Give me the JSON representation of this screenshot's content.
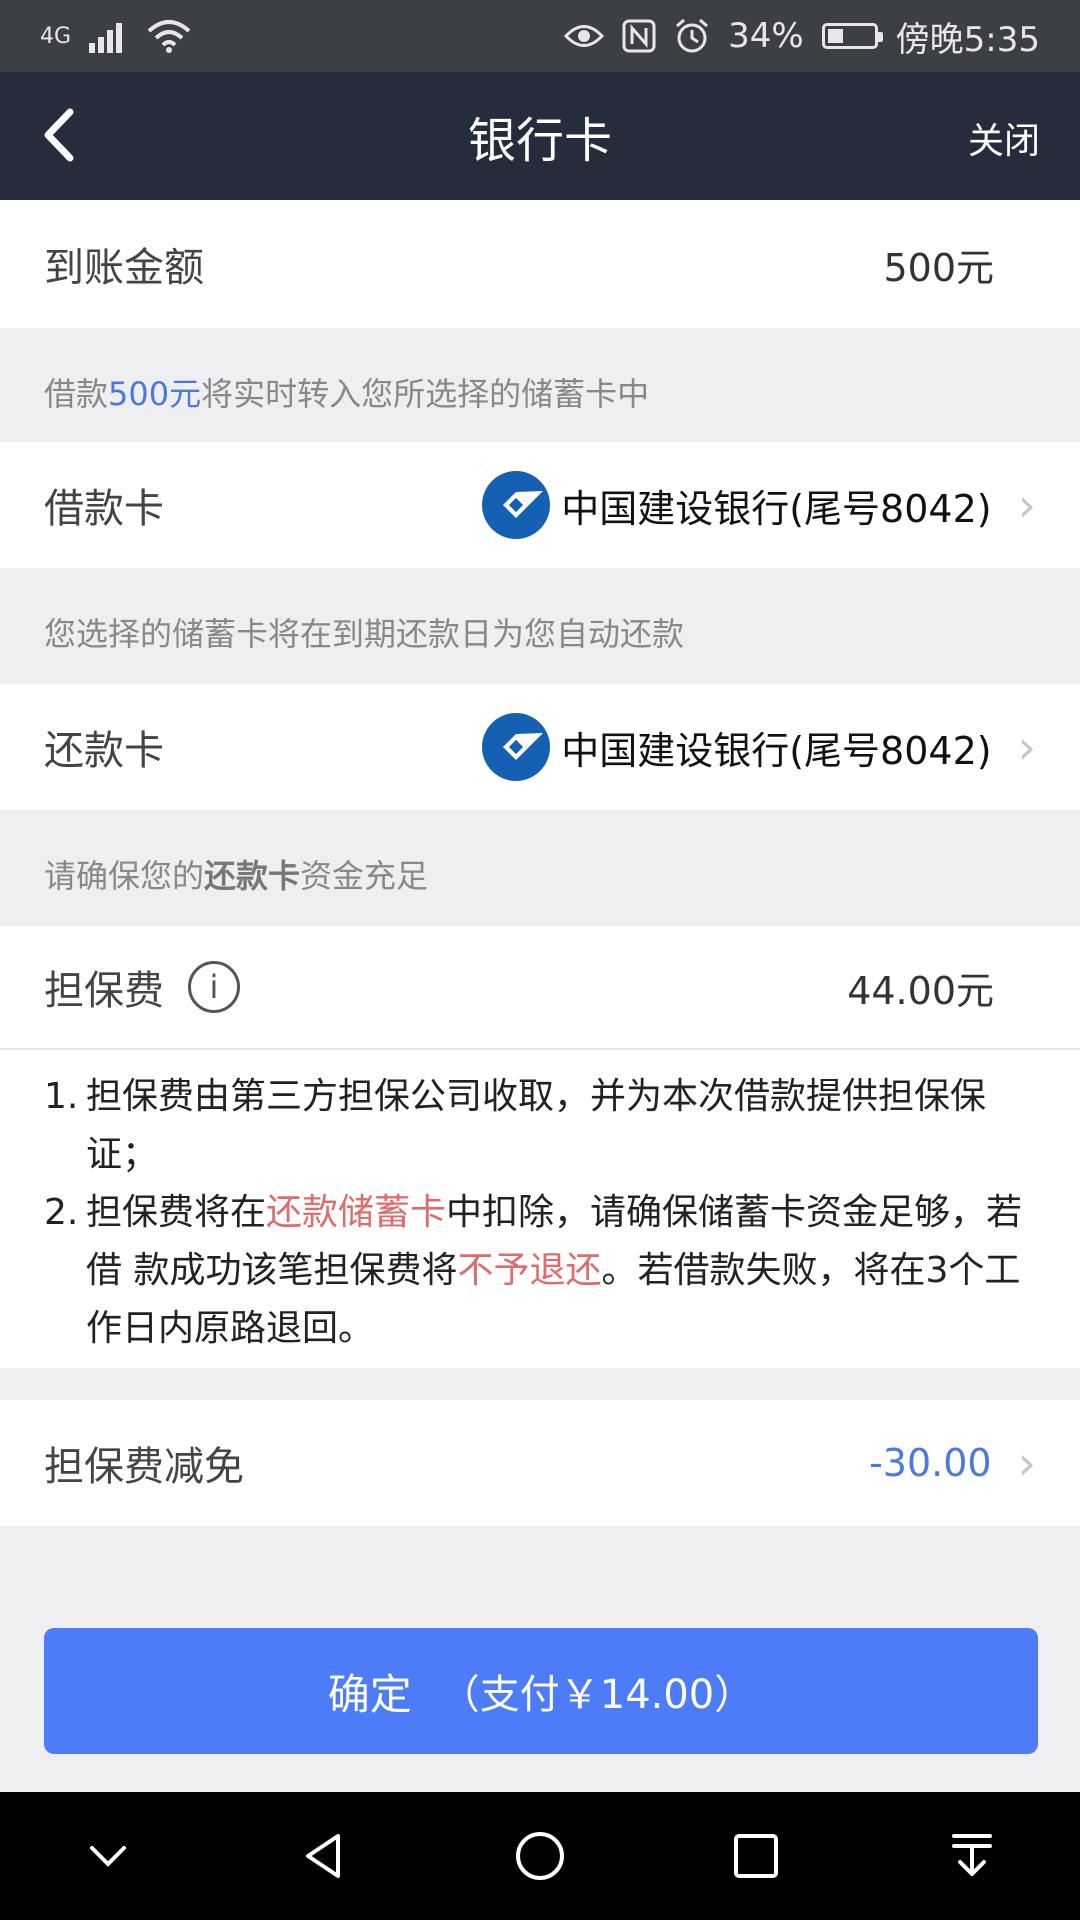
{
  "status_bar": {
    "network": "4G",
    "battery_percent": "34%",
    "battery_level": 34,
    "time": "傍晚5:35",
    "icons": [
      "signal-icon",
      "wifi-icon",
      "eye-icon",
      "nfc-icon",
      "alarm-icon",
      "battery-icon"
    ]
  },
  "nav": {
    "title": "银行卡",
    "close_label": "关闭"
  },
  "amount_row": {
    "label": "到账金额",
    "value": "500元"
  },
  "hint_transfer": {
    "prefix": "借款",
    "amount": "500元",
    "suffix": "将实时转入您所选择的储蓄卡中"
  },
  "loan_card": {
    "label": "借款卡",
    "bank": "中国建设银行(尾号8042)"
  },
  "hint_auto": {
    "text": "您选择的储蓄卡将在到期还款日为您自动还款"
  },
  "repay_card": {
    "label": "还款卡",
    "bank": "中国建设银行(尾号8042)"
  },
  "hint_funds": {
    "prefix": "请确保您的",
    "bold": "还款卡",
    "suffix": "资金充足"
  },
  "guarantee_fee": {
    "label": "担保费",
    "info_glyph": "i",
    "value": "44.00元"
  },
  "terms": [
    {
      "num": "1.",
      "text": "担保费由第三方担保公司收取，并为本次借款提供担保保证；"
    },
    {
      "num": "2.",
      "part1": "担保费将在",
      "red1": "还款储蓄卡",
      "part2": "中扣除，请确保储蓄卡资金足够，若借 款成功该笔担保费将",
      "red2": "不予退还",
      "part3": "。若借款失败，将在3个工作日内原路退回。"
    }
  ],
  "discount": {
    "label": "担保费减免",
    "value": "-30.00"
  },
  "confirm": {
    "label": "确定",
    "sub": "（支付￥14.00）"
  },
  "colors": {
    "nav_bg": "#262c3c",
    "accent_blue": "#4a79e0",
    "button_blue": "#4c7cf8",
    "warning_red": "#e06b6b",
    "bank_blue": "#1660b3"
  }
}
